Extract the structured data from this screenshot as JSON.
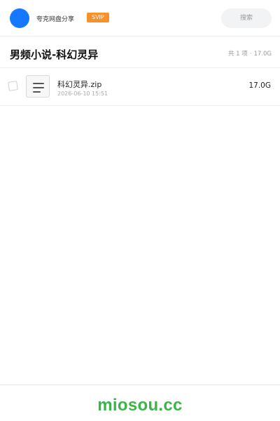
{
  "topbar": {
    "app_name": "夸克网盘分享",
    "badge": "SVIP",
    "search_placeholder": "搜索",
    "avatar_color": "#1677ff",
    "badge_color": "#f7922a"
  },
  "folder": {
    "title": "男频小说-科幻灵异",
    "count_text": "共 1 项",
    "separator": "·",
    "total_size": "17.0G"
  },
  "files": [
    {
      "name": "科幻灵异.zip",
      "date": "2026-06-10 15:51",
      "size": "17.0G",
      "icon": "document-icon",
      "checked": false
    }
  ],
  "footer": {
    "brand": "miosou.cc",
    "brand_color": "#3cb44a"
  }
}
